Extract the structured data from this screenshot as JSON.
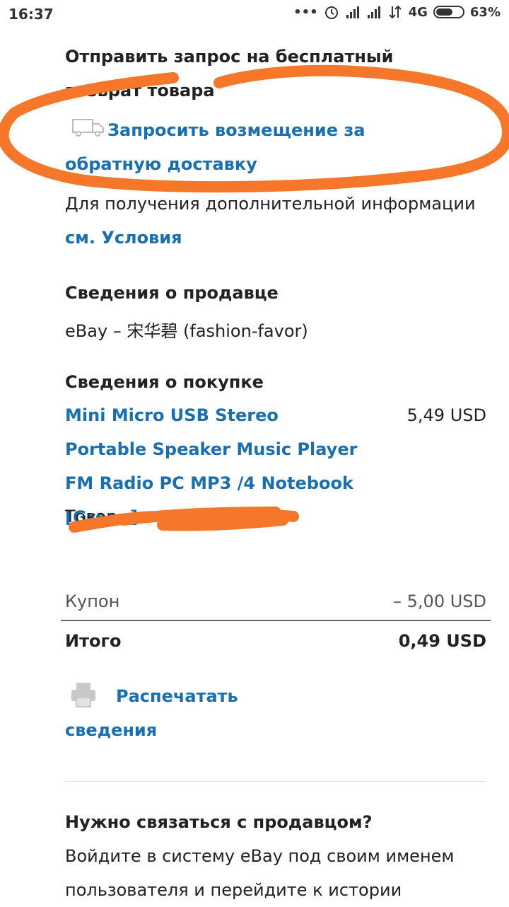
{
  "status": {
    "time": "16:37",
    "network": "4G",
    "battery": "63%",
    "battery_level": 0.63
  },
  "return": {
    "title": "Отправить запрос на бесплатный возврат товара",
    "refund_link": "Запросить возмещение за обратную доставку",
    "more_info": "Для получения дополнительной информации",
    "terms_link": "см. Условия"
  },
  "seller": {
    "heading": "Сведения о продавце",
    "value": "eBay – 宋华碧 (fashion-favor)"
  },
  "purchase": {
    "heading": "Сведения о покупке",
    "item_link": "Mini Micro USB Stereo Portable Speaker Music Player FM Radio PC MP3 /4 Notebook [Green]",
    "item_price": "5,49 USD",
    "item_number_partial": "Товар"
  },
  "totals": {
    "coupon_label": "Купон",
    "coupon_value": "– 5,00 USD",
    "total_label": "Итого",
    "total_value": "0,49 USD"
  },
  "print": {
    "link": "Распечатать сведения"
  },
  "contact": {
    "heading": "Нужно связаться с продавцом?",
    "text": "Войдите в систему eBay под своим именем пользователя и перейдите к истории"
  },
  "colors": {
    "link": "#1a6fb0",
    "annotation": "#f7772a"
  }
}
